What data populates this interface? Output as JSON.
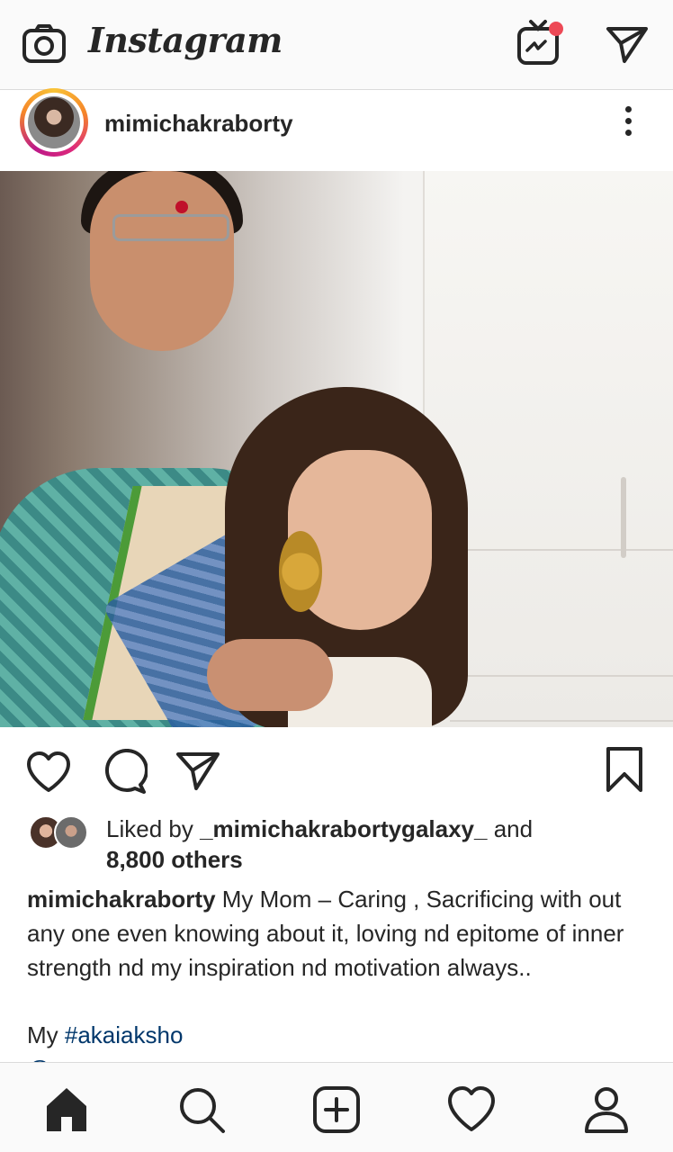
{
  "app": {
    "title": "Instagram"
  },
  "header": {
    "camera_icon": "camera-icon",
    "igtv_icon": "igtv-icon",
    "direct_icon": "paper-plane-icon"
  },
  "post": {
    "username": "mimichakraborty",
    "more_icon": "more-vertical-icon",
    "photo_description_alt": "",
    "actions": {
      "like_icon": "heart-icon",
      "comment_icon": "comment-icon",
      "share_icon": "paper-plane-icon",
      "save_icon": "bookmark-icon"
    },
    "likes": {
      "prefix": "Liked by ",
      "liker": "_mimichakrabortygalaxy_",
      "suffix": " and",
      "count": "8,800 others"
    },
    "caption": {
      "username": "mimichakraborty",
      "text": " My Mom – Caring , Sacrificing with out any one even knowing about it, loving nd epitome of inner strength nd my inspiration nd motivation always..",
      "tag_prefix": "My ",
      "hashtag": "#akaiaksho",
      "next_line": "@..."
    }
  },
  "bottom_nav": {
    "home_icon": "home-icon",
    "search_icon": "search-icon",
    "add_icon": "add-post-icon",
    "activity_icon": "heart-icon",
    "profile_icon": "profile-icon"
  },
  "colors": {
    "text": "#262626",
    "link": "#00376b",
    "notification_dot": "#ed4956",
    "bar_bg": "#fafafa",
    "divider": "#dbdbdb"
  }
}
